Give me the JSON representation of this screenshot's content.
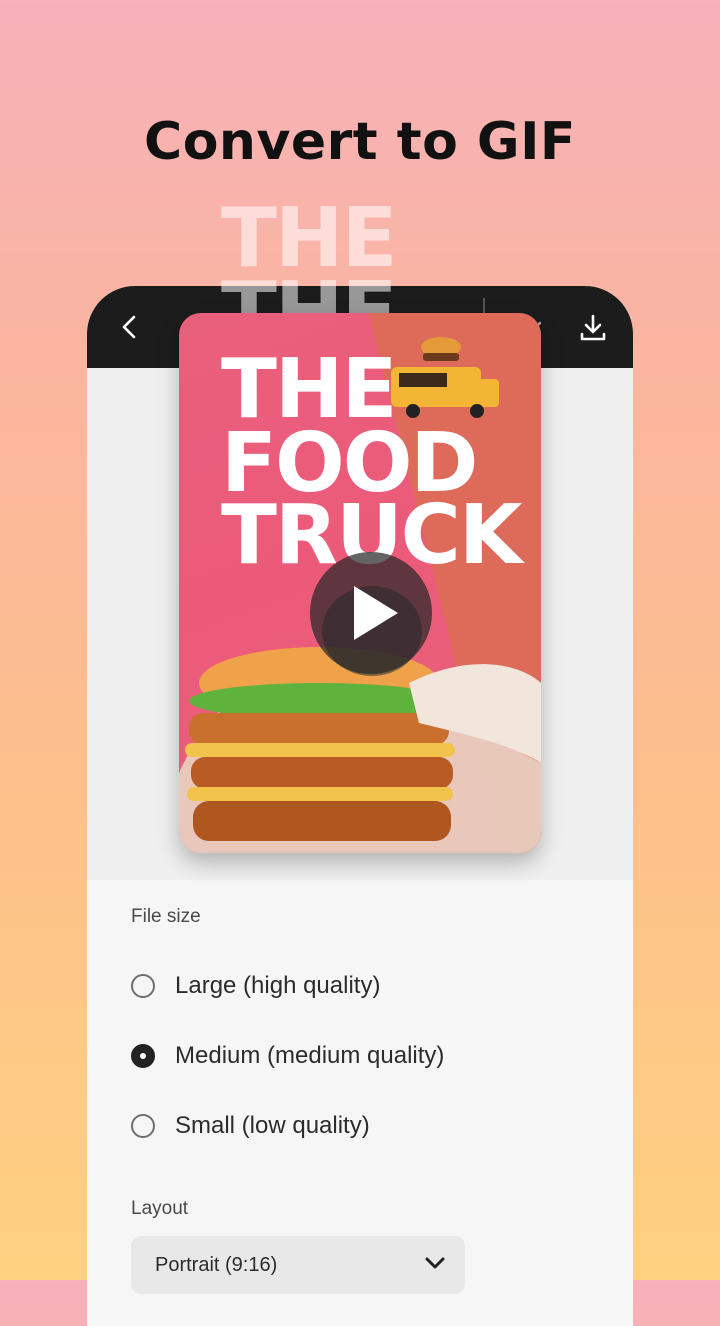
{
  "headline": "Convert to GIF",
  "poster": {
    "line1": "THE",
    "line2": "FOOD",
    "line3": "TRUCK"
  },
  "settings": {
    "file_size_label": "File size",
    "options": [
      {
        "label": "Large (high quality)",
        "selected": false
      },
      {
        "label": "Medium (medium quality)",
        "selected": true
      },
      {
        "label": "Small (low quality)",
        "selected": false
      }
    ],
    "layout_label": "Layout",
    "layout_value": "Portrait (9:16)"
  },
  "colors": {
    "accent_dark": "#1c1c1c",
    "poster_pink": "#ec5a7a",
    "poster_orange": "#de6a59"
  },
  "icons": [
    "back-arrow-icon",
    "download-icon",
    "play-icon",
    "chevron-down-icon"
  ]
}
